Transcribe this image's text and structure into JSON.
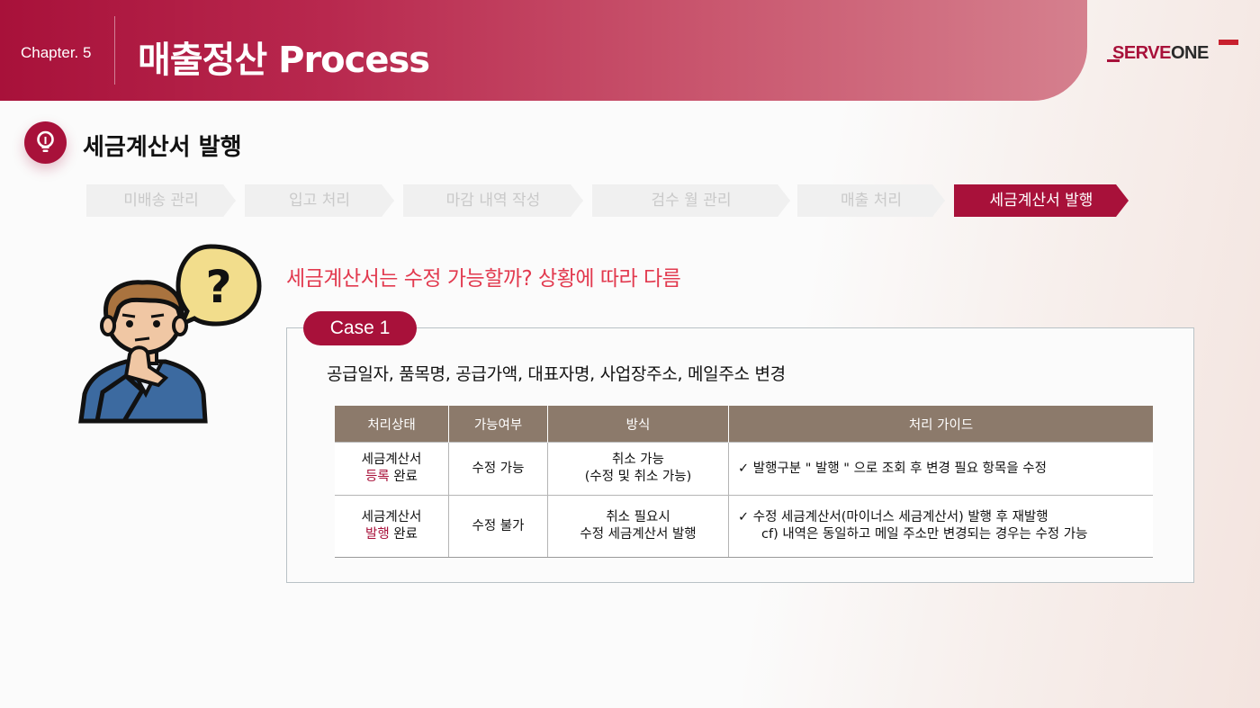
{
  "header": {
    "chapter": "Chapter. 5",
    "title": "매출정산 Process",
    "logo_part1": "SERVE",
    "logo_part2": "ONE"
  },
  "section": {
    "title": "세금계산서 발행",
    "icon": "lightbulb-icon"
  },
  "steps": [
    {
      "label": "미배송 관리",
      "active": false
    },
    {
      "label": "입고 처리",
      "active": false
    },
    {
      "label": "마감 내역 작성",
      "active": false
    },
    {
      "label": "검수 월 관리",
      "active": false
    },
    {
      "label": "매출 처리",
      "active": false
    },
    {
      "label": "세금계산서 발행",
      "active": true
    }
  ],
  "question": "세금계산서는 수정 가능할까?  상황에 따라 다름",
  "case": {
    "label": "Case 1",
    "description": "공급일자, 품목명, 공급가액, 대표자명, 사업장주소, 메일주소 변경"
  },
  "table": {
    "headers": [
      "처리상태",
      "가능여부",
      "방식",
      "처리 가이드"
    ],
    "rows": [
      {
        "status_line1": "세금계산서",
        "status_highlight": "등록",
        "status_suffix": " 완료",
        "possible": "수정 가능",
        "method_line1": "취소 가능",
        "method_line2": "(수정 및 취소 가능)",
        "guide_line1": "✓ 발행구분 \" 발행 \" 으로 조회 후 변경 필요 항목을 수정",
        "guide_line2": ""
      },
      {
        "status_line1": "세금계산서",
        "status_highlight": "발행",
        "status_suffix": " 완료",
        "possible": "수정 불가",
        "method_line1": "취소 필요시",
        "method_line2": "수정 세금계산서 발행",
        "guide_line1": "✓ 수정 세금계산서(마이너스 세금계산서) 발행 후 재발행",
        "guide_line2": "cf) 내역은 동일하고 메일 주소만 변경되는 경우는 수정 가능"
      }
    ]
  },
  "colors": {
    "brand": "#a8113a",
    "question": "#e23a4f",
    "table_header": "#8c7a6b"
  }
}
